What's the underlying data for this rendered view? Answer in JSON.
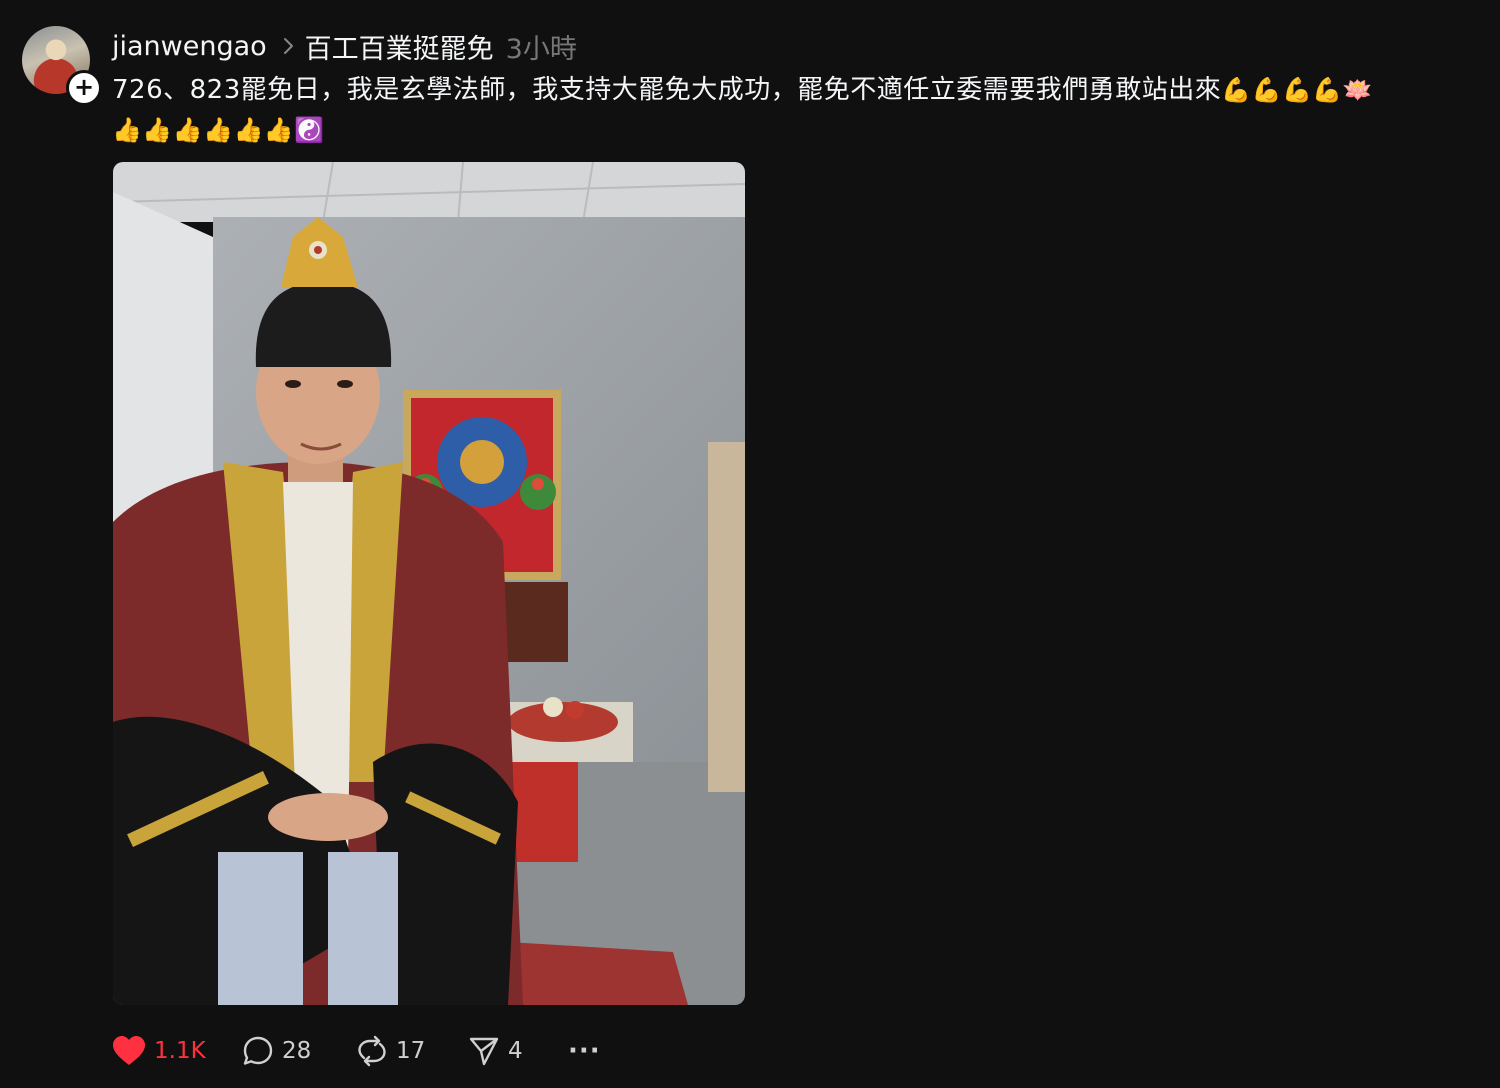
{
  "post": {
    "username": "jianwengao",
    "topic": "百工百業挺罷免",
    "time": "3小時",
    "avatar_alt": "avatar",
    "follow_symbol": "+",
    "caption_line1": "726、823罷免日，我是玄學法師，我支持大罷免大成功，罷免不適任立委需要我們勇敢站出來",
    "caption_line1_emoji": "💪💪💪💪🪷",
    "caption_line2_emoji": "👍👍👍👍👍👍☯️",
    "photo_alt": "Man in red and gold embroidered Taoist priest robe with golden crown standing in front of an altar"
  },
  "actions": {
    "likes": "1.1K",
    "replies": "28",
    "reposts": "17",
    "shares": "4",
    "more": "···"
  },
  "colors": {
    "background": "#101010",
    "text": "#f3f5f7",
    "muted": "#777777",
    "like": "#ff3040"
  },
  "icons": [
    "chevron-right-icon",
    "heart-icon",
    "comment-icon",
    "repost-icon",
    "share-icon",
    "more-icon",
    "plus-icon"
  ]
}
